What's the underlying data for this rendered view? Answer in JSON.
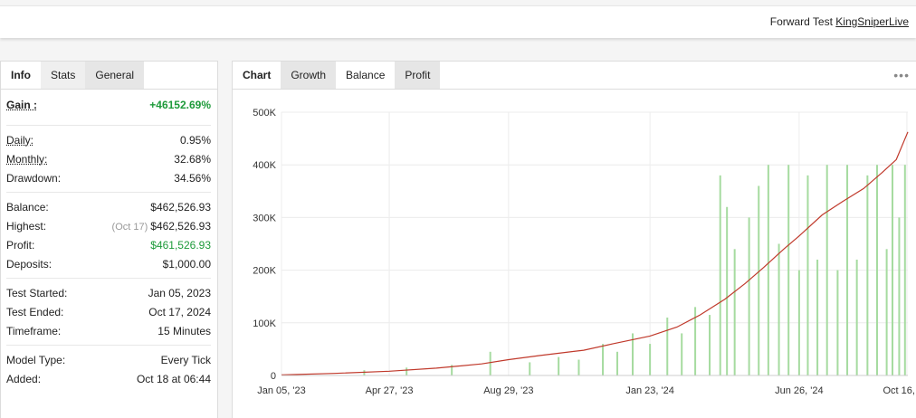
{
  "header": {
    "forward_label": "Forward Test",
    "account_link": "KingSniperLive"
  },
  "left_tabs": [
    {
      "label": "Info"
    },
    {
      "label": "Stats"
    },
    {
      "label": "General"
    }
  ],
  "stats": {
    "gain": {
      "label": "Gain :",
      "value": "+46152.69%"
    },
    "daily": {
      "label": "Daily:",
      "value": "0.95%"
    },
    "monthly": {
      "label": "Monthly:",
      "value": "32.68%"
    },
    "drawdown": {
      "label": "Drawdown:",
      "value": "34.56%"
    },
    "balance": {
      "label": "Balance:",
      "value": "$462,526.93"
    },
    "highest": {
      "label": "Highest:",
      "date": "(Oct 17)",
      "value": "$462,526.93"
    },
    "profit": {
      "label": "Profit:",
      "value": "$461,526.93"
    },
    "deposits": {
      "label": "Deposits:",
      "value": "$1,000.00"
    },
    "test_started": {
      "label": "Test Started:",
      "value": "Jan 05, 2023"
    },
    "test_ended": {
      "label": "Test Ended:",
      "value": "Oct 17, 2024"
    },
    "timeframe": {
      "label": "Timeframe:",
      "value": "15 Minutes"
    },
    "model_type": {
      "label": "Model Type:",
      "value": "Every Tick"
    },
    "added": {
      "label": "Added:",
      "value": "Oct 18 at 06:44"
    }
  },
  "chart_tabs": [
    {
      "label": "Chart"
    },
    {
      "label": "Growth"
    },
    {
      "label": "Balance"
    },
    {
      "label": "Profit"
    }
  ],
  "colors": {
    "line": "#c0392b",
    "bars": "#a6dba0",
    "green_text": "#1d9a3a"
  },
  "chart_data": {
    "type": "line",
    "title": "",
    "xlabel": "",
    "ylabel": "",
    "ylim": [
      0,
      500000
    ],
    "yticks": [
      0,
      100000,
      200000,
      300000,
      400000,
      500000
    ],
    "ytick_labels": [
      "0",
      "100K",
      "200K",
      "300K",
      "400K",
      "500K"
    ],
    "xticks": [
      "2023-01-05",
      "2023-04-27",
      "2023-08-29",
      "2024-01-23",
      "2024-06-26",
      "2024-10-16"
    ],
    "xtick_labels": [
      "Jan 05, '23",
      "Apr 27, '23",
      "Aug 29, '23",
      "Jan 23, '24",
      "Jun 26, '24",
      "Oct 16, '24"
    ],
    "xrange": [
      "2023-01-05",
      "2024-10-17"
    ],
    "grid": true,
    "series": [
      {
        "type": "line",
        "x": [
          "2023-01-05",
          "2023-03-01",
          "2023-04-27",
          "2023-06-15",
          "2023-08-01",
          "2023-08-29",
          "2023-10-01",
          "2023-11-15",
          "2023-12-15",
          "2024-01-23",
          "2024-02-20",
          "2024-03-15",
          "2024-04-10",
          "2024-05-01",
          "2024-05-20",
          "2024-06-10",
          "2024-06-26",
          "2024-07-20",
          "2024-08-10",
          "2024-09-01",
          "2024-09-20",
          "2024-10-05",
          "2024-10-17"
        ],
        "y": [
          1000,
          4000,
          8000,
          14000,
          22000,
          30000,
          38000,
          48000,
          60000,
          75000,
          92000,
          115000,
          145000,
          175000,
          205000,
          240000,
          265000,
          305000,
          330000,
          355000,
          385000,
          410000,
          462527
        ]
      },
      {
        "type": "bar",
        "x": [
          "2023-04-01",
          "2023-05-15",
          "2023-07-01",
          "2023-08-10",
          "2023-09-20",
          "2023-10-20",
          "2023-11-10",
          "2023-12-05",
          "2023-12-20",
          "2024-01-05",
          "2024-01-23",
          "2024-02-10",
          "2024-02-25",
          "2024-03-10",
          "2024-03-25",
          "2024-04-05",
          "2024-04-12",
          "2024-04-20",
          "2024-05-05",
          "2024-05-15",
          "2024-05-25",
          "2024-06-05",
          "2024-06-15",
          "2024-06-26",
          "2024-07-05",
          "2024-07-15",
          "2024-07-25",
          "2024-08-05",
          "2024-08-15",
          "2024-08-25",
          "2024-09-05",
          "2024-09-15",
          "2024-09-25",
          "2024-10-01",
          "2024-10-08",
          "2024-10-14"
        ],
        "y": [
          10000,
          15000,
          20000,
          45000,
          25000,
          35000,
          30000,
          60000,
          45000,
          80000,
          60000,
          110000,
          80000,
          130000,
          115000,
          380000,
          320000,
          240000,
          300000,
          360000,
          400000,
          250000,
          400000,
          200000,
          380000,
          220000,
          400000,
          200000,
          400000,
          220000,
          380000,
          400000,
          240000,
          400000,
          300000,
          400000
        ]
      }
    ]
  }
}
